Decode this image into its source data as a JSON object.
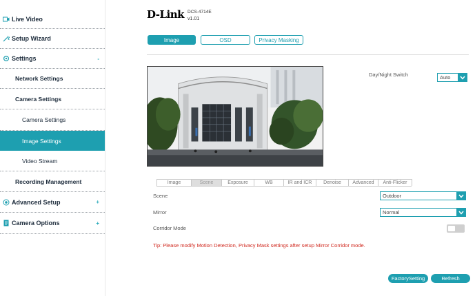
{
  "sidebar": {
    "live_video": "Live Video",
    "setup_wizard": "Setup Wizard",
    "settings": "Settings",
    "settings_arrow": "-",
    "network_settings": "Network Settings",
    "camera_settings": "Camera Settings",
    "camera_settings_sub": "Camera Settings",
    "image_settings": "Image Settings",
    "video_stream": "Video Stream",
    "recording_management": "Recording Management",
    "advanced_setup": "Advanced Setup",
    "advanced_arrow": "+",
    "camera_options": "Camera Options",
    "camera_options_arrow": "+"
  },
  "header": {
    "brand": "D-Link",
    "model": "DCS-4714E",
    "version": "v1.01"
  },
  "top_tabs": {
    "image": "Image",
    "osd": "OSD",
    "privacy": "Privacy Masking"
  },
  "day_night": {
    "label": "Day/Night Switch",
    "value": "Auto"
  },
  "sub_tabs": [
    "Image",
    "Scene",
    "Exposure",
    "WB",
    "IR and ICR",
    "Denoise",
    "Advanced",
    "Anti-Flicker"
  ],
  "scene": {
    "label": "Scene",
    "value": "Outdoor"
  },
  "mirror": {
    "label": "Mirror",
    "value": "Normal"
  },
  "corridor": {
    "label": "Corridor Mode"
  },
  "tip": "Tip: Please modify Motion Detection, Privacy Mask settings after setup Mirror Corridor mode.",
  "buttons": {
    "factory": "FactorySetting",
    "refresh": "Refresh"
  },
  "colors": {
    "accent": "#1e9fb0",
    "tip": "#d0281e"
  }
}
